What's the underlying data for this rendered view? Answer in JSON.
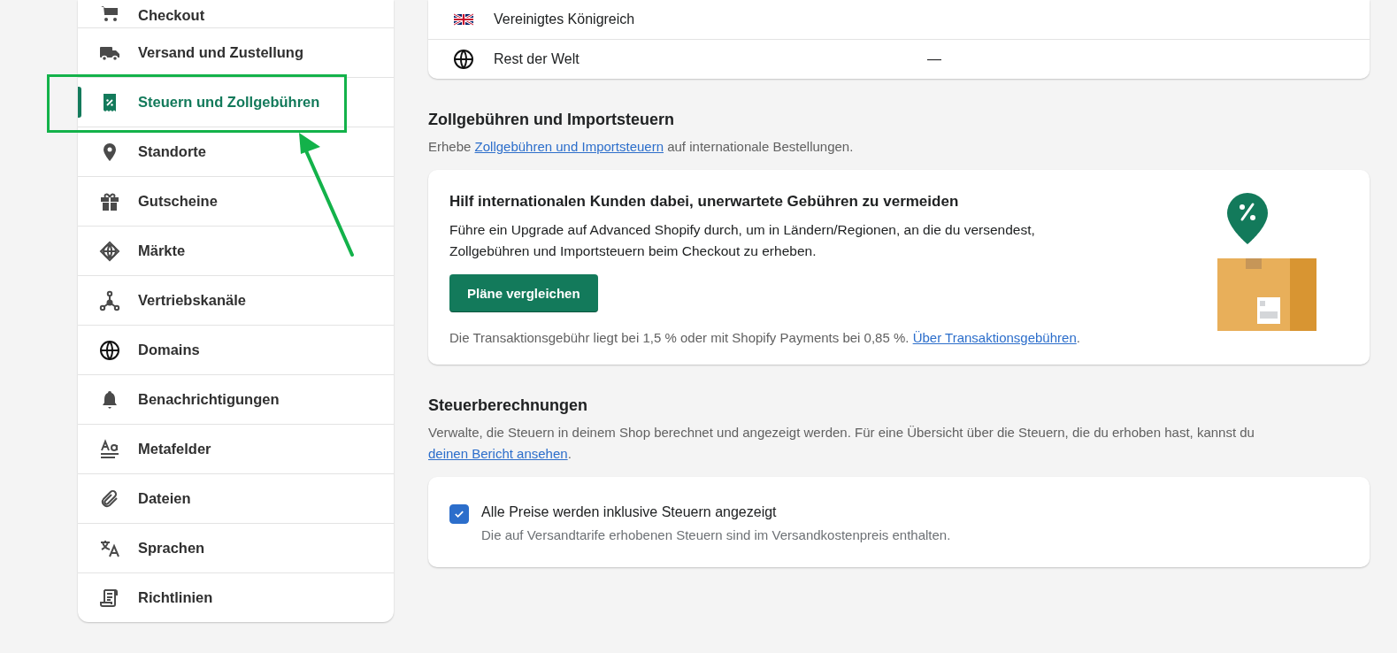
{
  "sidebar": {
    "items": [
      {
        "label": "Checkout",
        "selected": false
      },
      {
        "label": "Versand und Zustellung",
        "selected": false
      },
      {
        "label": "Steuern und Zollgebühren",
        "selected": true
      },
      {
        "label": "Standorte",
        "selected": false
      },
      {
        "label": "Gutscheine",
        "selected": false
      },
      {
        "label": "Märkte",
        "selected": false
      },
      {
        "label": "Vertriebskanäle",
        "selected": false
      },
      {
        "label": "Domains",
        "selected": false
      },
      {
        "label": "Benachrichtigungen",
        "selected": false
      },
      {
        "label": "Metafelder",
        "selected": false
      },
      {
        "label": "Dateien",
        "selected": false
      },
      {
        "label": "Sprachen",
        "selected": false
      },
      {
        "label": "Richtlinien",
        "selected": false
      }
    ]
  },
  "regions": [
    {
      "name": "Vereinigtes Königreich"
    },
    {
      "name": "Rest der Welt",
      "value": "—"
    }
  ],
  "duties": {
    "title": "Zollgebühren und Importsteuern",
    "intro": "Erhebe",
    "intro_link": "Zollgebühren und Importsteuern",
    "intro_end": "auf internationale Bestellungen.",
    "card_title": "Hilf internationalen Kunden dabei, unerwartete Gebühren zu vermeiden",
    "card_text": "Führe ein Upgrade auf Advanced Shopify durch, um in Ländern/Regionen, an die du versendest, Zollgebühren und Importsteuern beim Checkout zu erheben.",
    "button": "Pläne vergleichen",
    "footer": "Die Transaktionsgebühr liegt bei 1,5 % oder mit Shopify Payments bei 0,85 %.",
    "footer_link": "Über Transaktionsgebühren",
    "footer_end": "."
  },
  "calc": {
    "title": "Steuerberechnungen",
    "intro": "Verwalte, die Steuern in deinem Shop berechnet und angezeigt werden. Für eine Übersicht über die Steuern, die du erhoben hast, kannst du",
    "intro_link": "deinen Bericht ansehen",
    "intro_end": ".",
    "options": [
      {
        "label": "Alle Preise werden inklusive Steuern angezeigt",
        "help": "Die auf Versandtarife erhobenen Steuern sind im Versandkostenpreis enthalten.",
        "checked": true
      }
    ]
  }
}
